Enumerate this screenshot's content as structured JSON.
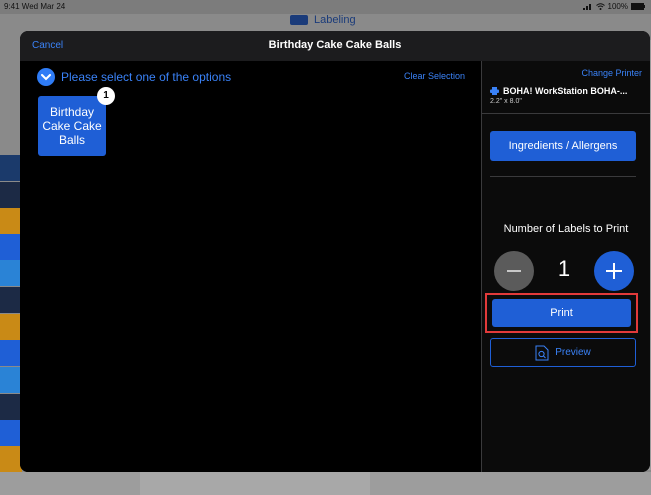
{
  "status_bar": {
    "time": "9:41 Wed Mar 24",
    "battery": "100%"
  },
  "background_app": {
    "title": "Labeling"
  },
  "modal": {
    "cancel_label": "Cancel",
    "title": "Birthday Cake Cake Balls",
    "select_prompt": "Please select one of the options",
    "clear_selection_label": "Clear Selection",
    "options": [
      {
        "label": "Birthday Cake Cake Balls",
        "badge": "1"
      }
    ]
  },
  "printer_panel": {
    "change_printer_label": "Change Printer",
    "printer_name": "BOHA! WorkStation BOHA-...",
    "label_size": "2.2\" x 8.0\"",
    "ingredients_label": "Ingredients / Allergens",
    "num_labels_title": "Number of Labels to Print",
    "count": "1",
    "print_label": "Print",
    "preview_label": "Preview"
  },
  "colors": {
    "accent": "#1f5fd6",
    "link": "#3a82f7",
    "highlight": "#e23a3a"
  }
}
